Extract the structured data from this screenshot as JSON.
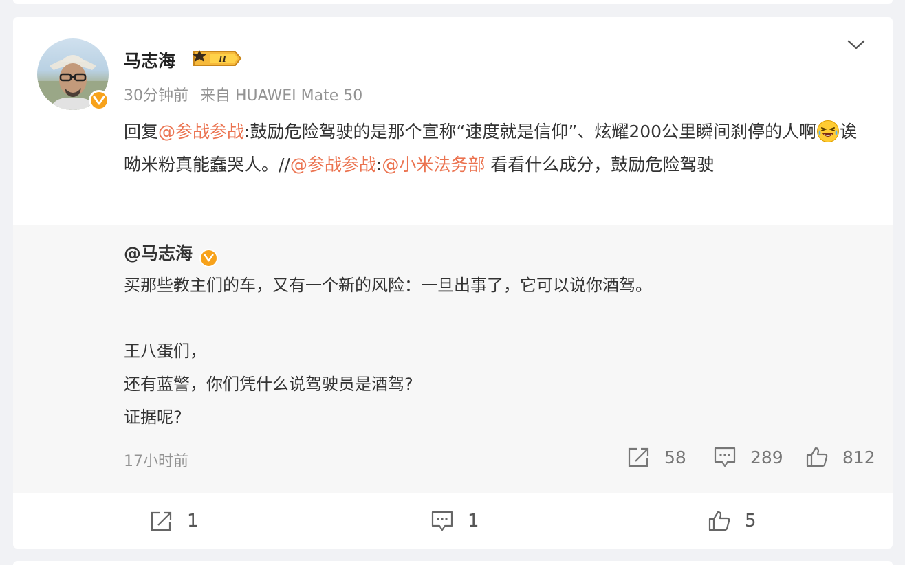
{
  "post": {
    "author": "马志海",
    "time": "30分钟前",
    "source": "来自 HUAWEI Mate 50",
    "text": {
      "prefix": "回复",
      "mention1": "@参战参战",
      "body1": ":鼓励危险驾驶的是那个宣称“速度就是信仰”、炫耀200公里瞬间刹停的人啊",
      "body2": "诶呦米粉真能蠢哭人。//",
      "mention2": "@参战参战",
      "colon": ":",
      "mention3": "@小米法务部",
      "body3": " 看看什么成分，鼓励危险驾驶"
    },
    "actions": {
      "repost": "1",
      "comment": "1",
      "like": "5"
    }
  },
  "repost": {
    "author": "@马志海",
    "lines": [
      "买那些教主们的车，又有一个新的风险：一旦出事了，它可以说你酒驾。",
      "",
      "王八蛋们，",
      "还有蓝警，你们凭什么说驾驶员是酒驾?",
      "证据呢?"
    ],
    "time": "17小时前",
    "actions": {
      "repost": "58",
      "comment": "289",
      "like": "812"
    }
  },
  "icons": {
    "level_badge": "level-badge-icon",
    "verified": "verified-v-icon",
    "expand": "chevron-down-icon",
    "repost": "repost-icon",
    "comment": "comment-icon",
    "like": "thumb-up-icon",
    "emoji": "laughing-crying-emoji-icon"
  },
  "colors": {
    "mention": "#eb7350",
    "verified_badge": "#f7a21b",
    "meta_text": "#939393",
    "repost_bg": "#f7f7f7",
    "page_bg": "#f1f2f5"
  }
}
